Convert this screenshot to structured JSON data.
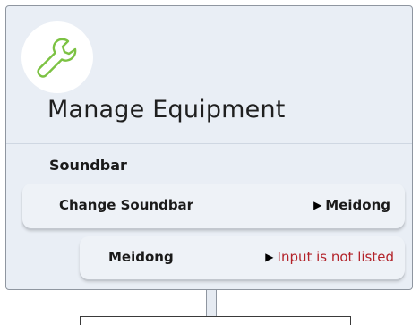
{
  "header": {
    "icon": "wrench-icon",
    "title": "Manage Equipment"
  },
  "section": {
    "label": "Soundbar"
  },
  "change_row": {
    "label": "Change Soundbar",
    "value": "Meidong"
  },
  "input_row": {
    "label": "Meidong",
    "action": "Input is not listed"
  },
  "colors": {
    "panel_bg": "#e9eef5",
    "accent_icon": "#7cc243",
    "warning_text": "#b3232a"
  }
}
